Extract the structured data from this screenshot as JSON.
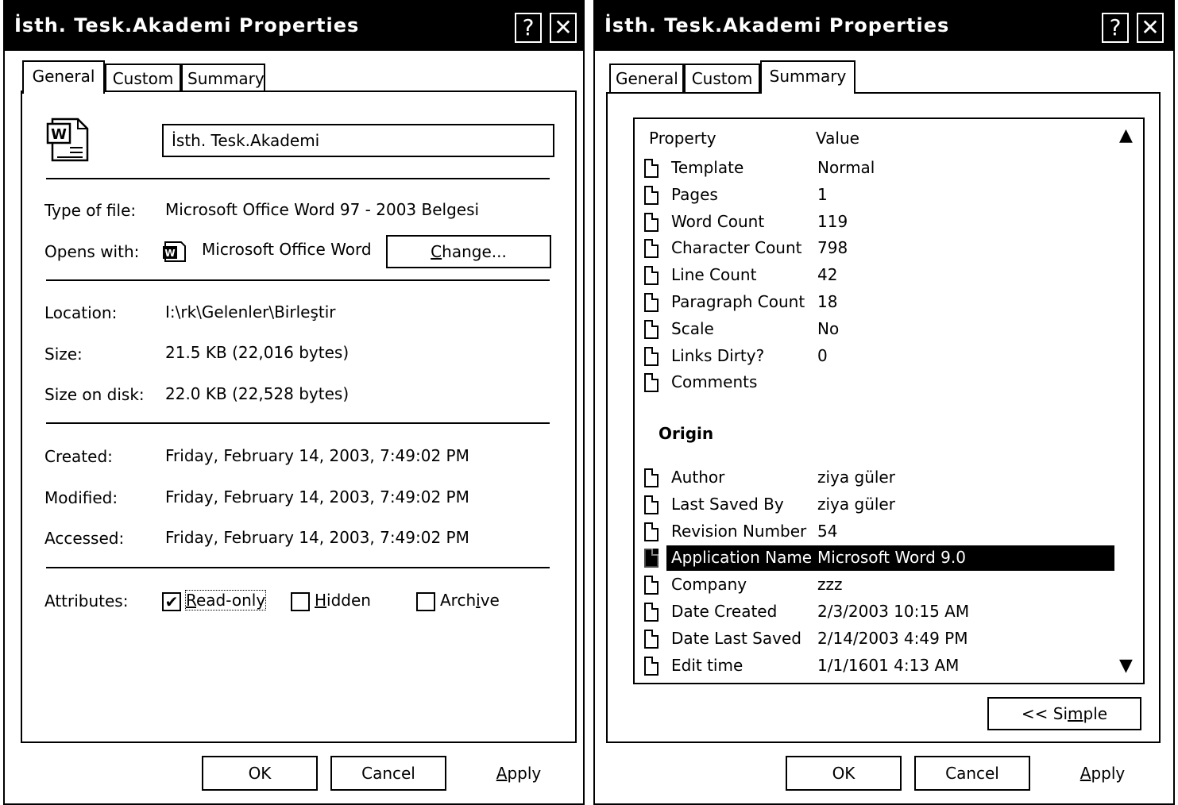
{
  "colors": {
    "background": "#ffffff",
    "title_bar": "#000000",
    "selection": "#000000"
  },
  "left_dialog": {
    "title": "İsth. Tesk.Akademi Properties",
    "help_button": "?",
    "close_button": "✕",
    "tabs": [
      "General",
      "Custom",
      "Summary"
    ],
    "active_tab": "General",
    "file_icon": "word-document-icon",
    "file_name": "İsth. Tesk.Akademi",
    "type_of_file_label": "Type of file:",
    "type_of_file_value": "Microsoft Office Word 97 - 2003 Belgesi",
    "opens_with_label": "Opens with:",
    "opens_with_icon": "word-app-icon",
    "opens_with_value": "Microsoft Office Word",
    "change_button": {
      "accel": "C",
      "rest": "hange..."
    },
    "location_label": "Location:",
    "location_value": "I:\\rk\\Gelenler\\Birleştir",
    "size_label": "Size:",
    "size_value": "21.5 KB (22,016 bytes)",
    "size_on_disk_label": "Size on disk:",
    "size_on_disk_value": "22.0 KB (22,528 bytes)",
    "created_label": "Created:",
    "created_value": "Friday, February 14, 2003, 7:49:02 PM",
    "modified_label": "Modified:",
    "modified_value": "Friday, February 14, 2003, 7:49:02 PM",
    "accessed_label": "Accessed:",
    "accessed_value": "Friday, February 14, 2003, 7:49:02 PM",
    "attributes_label": "Attributes:",
    "attributes": {
      "read_only": {
        "accel": "R",
        "rest": "ead-only",
        "checked": true
      },
      "hidden": {
        "accel": "H",
        "rest": "idden",
        "checked": false
      },
      "archive": {
        "pre": "Arch",
        "accel": "i",
        "rest": "ve",
        "checked": false
      }
    },
    "ok_button": "OK",
    "cancel_button": "Cancel",
    "apply_button": {
      "accel": "A",
      "rest": "pply"
    }
  },
  "right_dialog": {
    "title": "İsth. Tesk.Akademi Properties",
    "help_button": "?",
    "close_button": "✕",
    "tabs": [
      "General",
      "Custom",
      "Summary"
    ],
    "active_tab": "Summary",
    "column_property": "Property",
    "column_value": "Value",
    "scroll_up": "▲",
    "scroll_down": "▼",
    "rows_top": [
      {
        "name": "Template",
        "value": "Normal"
      },
      {
        "name": "Pages",
        "value": "1"
      },
      {
        "name": "Word Count",
        "value": "119"
      },
      {
        "name": "Character Count",
        "value": "798"
      },
      {
        "name": "Line Count",
        "value": "42"
      },
      {
        "name": "Paragraph Count",
        "value": "18"
      },
      {
        "name": "Scale",
        "value": "No"
      },
      {
        "name": "Links Dirty?",
        "value": "0"
      },
      {
        "name": "Comments",
        "value": ""
      }
    ],
    "section_origin": "Origin",
    "rows_origin": [
      {
        "name": "Author",
        "value": "ziya güler"
      },
      {
        "name": "Last Saved By",
        "value": "ziya güler"
      },
      {
        "name": "Revision Number",
        "value": "54"
      },
      {
        "name": "Application Name",
        "value": "Microsoft Word 9.0",
        "selected": true
      },
      {
        "name": "Company",
        "value": "zzz"
      },
      {
        "name": "Date Created",
        "value": "2/3/2003 10:15 AM"
      },
      {
        "name": "Date Last Saved",
        "value": "2/14/2003 4:49 PM"
      },
      {
        "name": "Edit time",
        "value": "1/1/1601 4:13 AM"
      }
    ],
    "simple_button": {
      "pre": "<< Si",
      "accel": "m",
      "rest": "ple"
    },
    "ok_button": "OK",
    "cancel_button": "Cancel",
    "apply_button": {
      "accel": "A",
      "rest": "pply"
    }
  }
}
